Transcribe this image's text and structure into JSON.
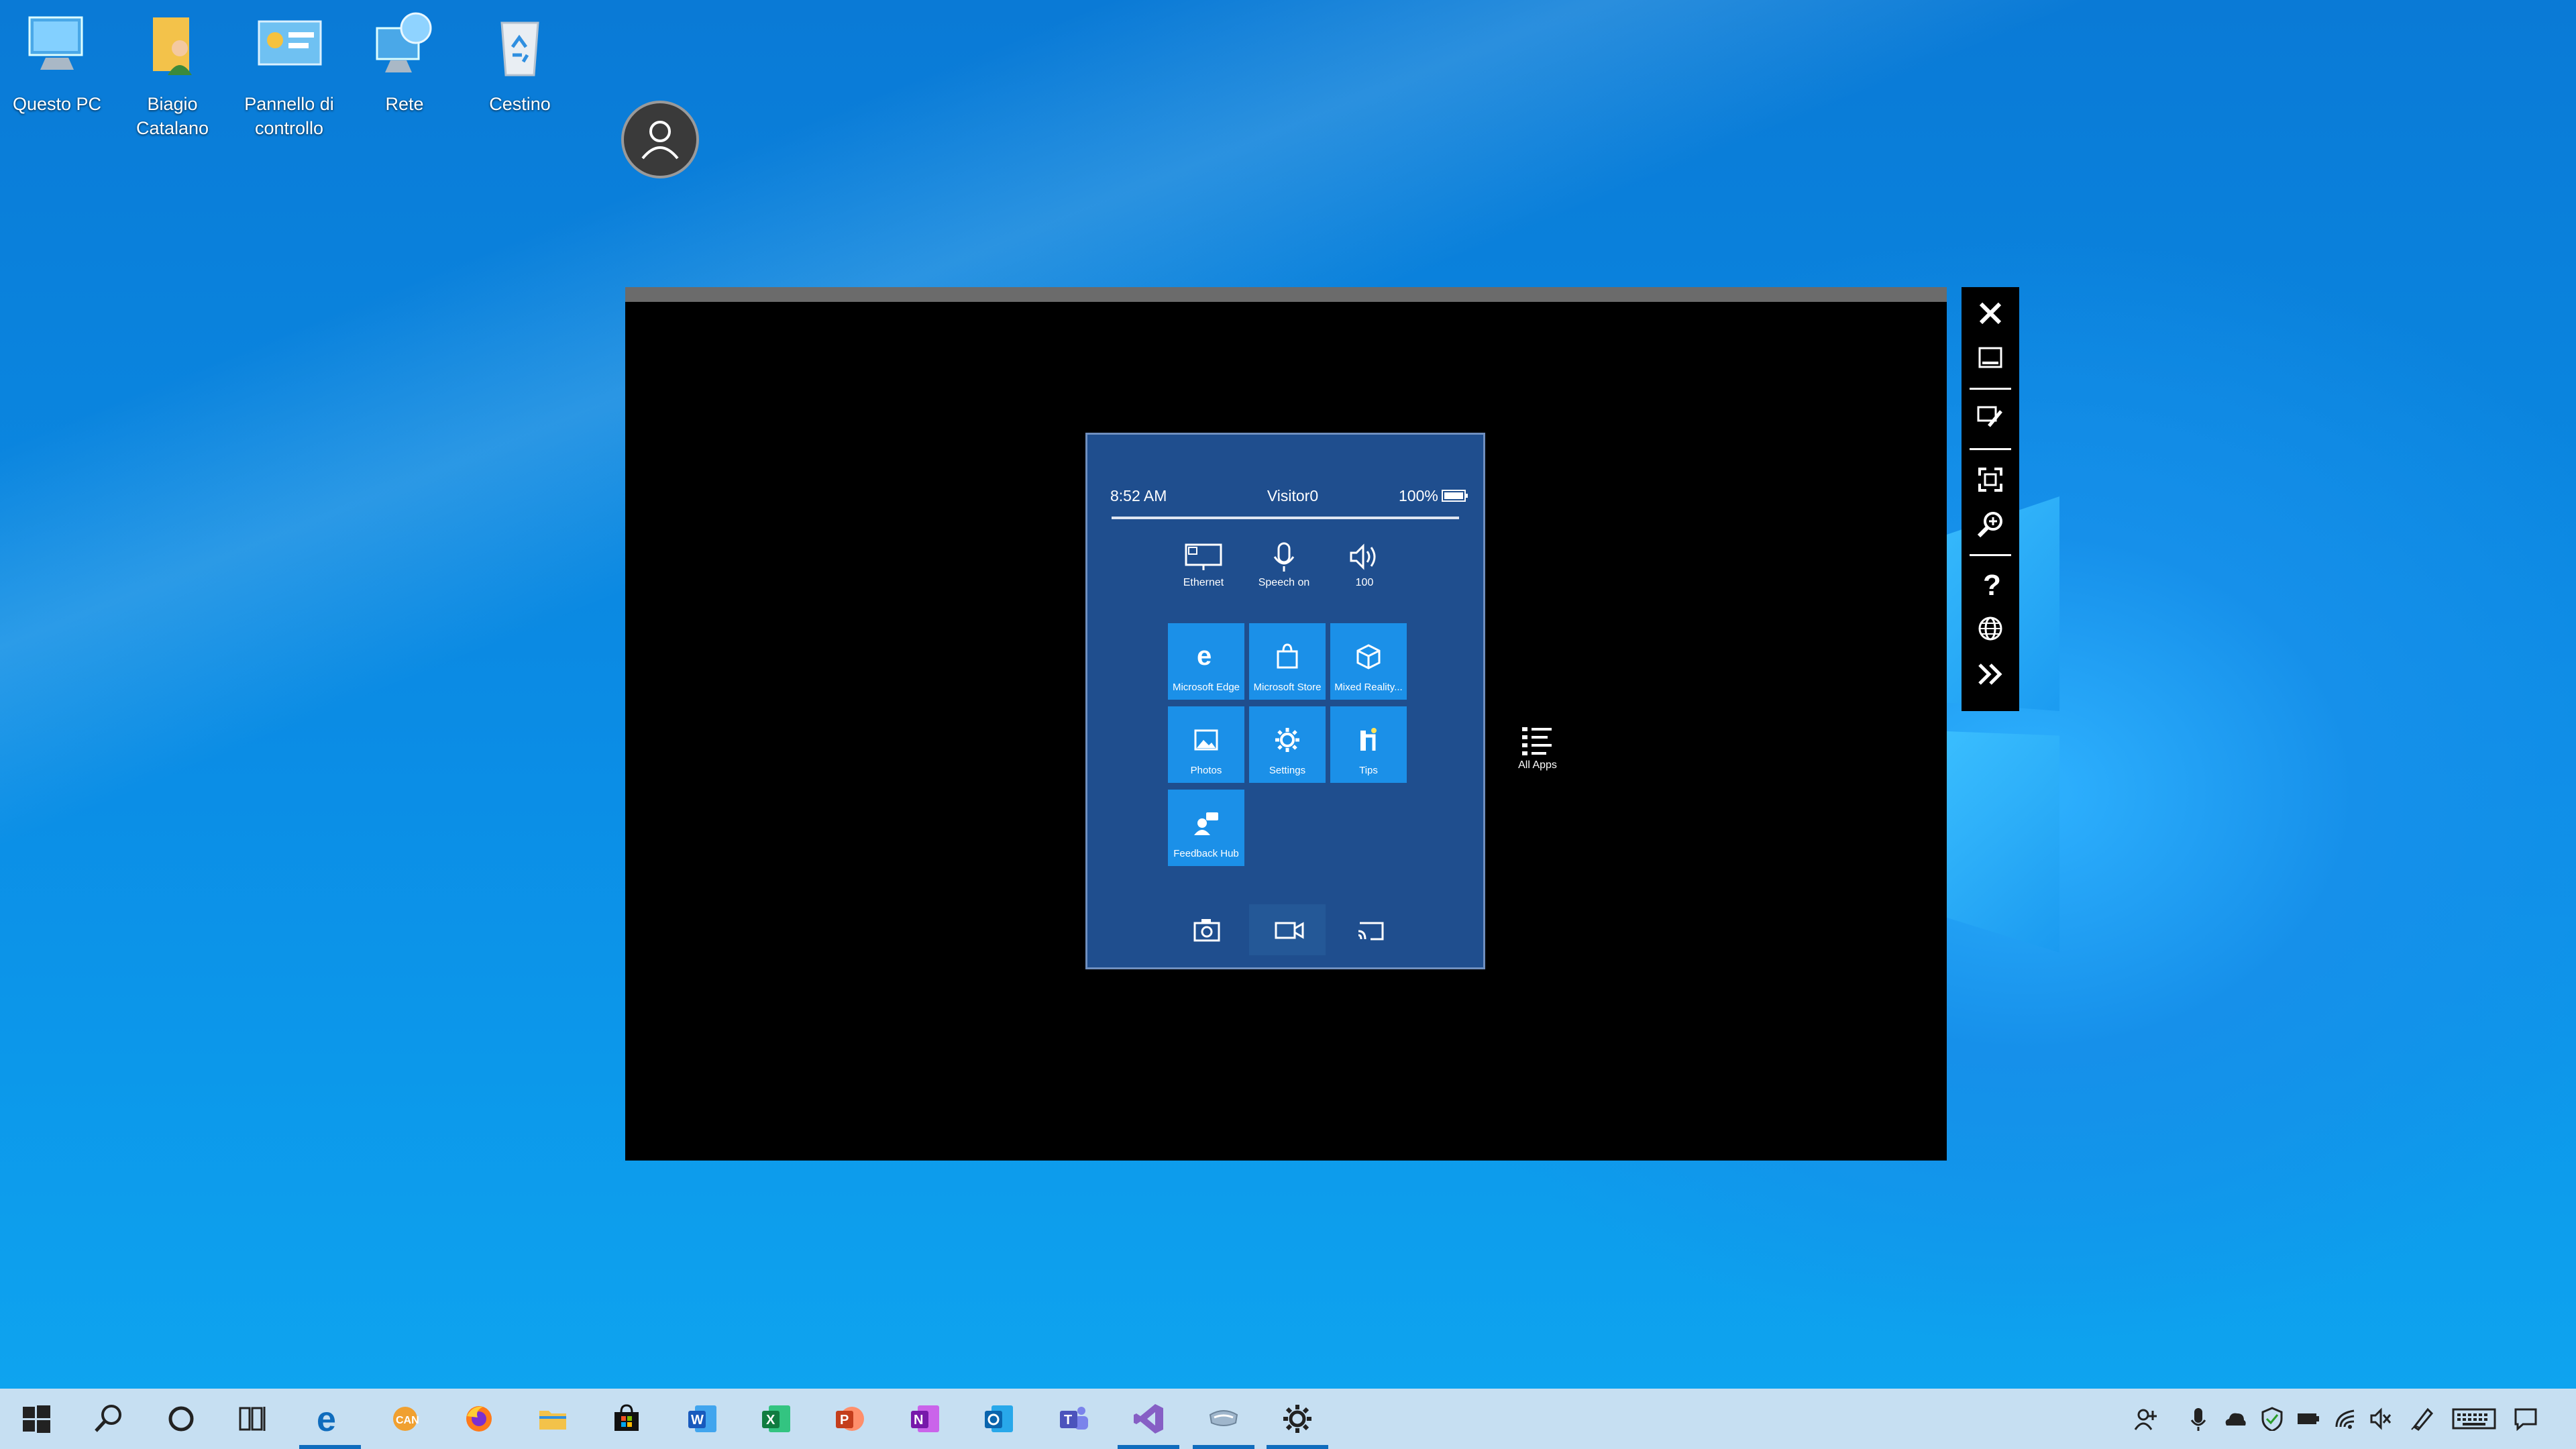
{
  "desktop": {
    "icons": [
      {
        "label": "Questo PC"
      },
      {
        "label": "Biagio Catalano"
      },
      {
        "label": "Pannello di controllo"
      },
      {
        "label": "Rete"
      },
      {
        "label": "Cestino"
      }
    ]
  },
  "emulator": {
    "status": {
      "time": "8:52 AM",
      "user": "Visitor0",
      "battery": "100%"
    },
    "quick_actions": [
      {
        "label": "Ethernet",
        "icon": "monitor-network-icon"
      },
      {
        "label": "Speech on",
        "icon": "microphone-icon"
      },
      {
        "label": "100",
        "icon": "volume-icon"
      }
    ],
    "tiles": [
      {
        "label": "Microsoft Edge",
        "icon": "edge-icon"
      },
      {
        "label": "Microsoft Store",
        "icon": "store-icon"
      },
      {
        "label": "Mixed Reality...",
        "icon": "cube-icon"
      },
      {
        "label": "Photos",
        "icon": "photos-icon"
      },
      {
        "label": "Settings",
        "icon": "gear-icon"
      },
      {
        "label": "Tips",
        "icon": "tips-icon"
      },
      {
        "label": "Feedback Hub",
        "icon": "feedback-icon"
      }
    ],
    "all_apps": "All Apps",
    "bottom_actions": [
      "camera-icon",
      "video-icon",
      "cast-icon"
    ]
  },
  "toolbar": {
    "tools": [
      "close-icon",
      "minimize-icon",
      "tools-icon",
      "fit-screen-icon",
      "zoom-icon",
      "help-icon",
      "globe-icon",
      "expand-icon"
    ]
  },
  "taskbar": {
    "apps": [
      "start-icon",
      "search-icon",
      "cortana-icon",
      "task-view-icon",
      "edge-icon",
      "canary-icon",
      "firefox-icon",
      "file-explorer-icon",
      "store-icon",
      "word-icon",
      "excel-icon",
      "powerpoint-icon",
      "onenote-icon",
      "outlook-icon",
      "teams-icon",
      "visual-studio-icon",
      "hololens-emulator-icon",
      "settings-icon"
    ],
    "tray": [
      "people-icon",
      "microphone-icon",
      "onedrive-icon",
      "defender-icon",
      "battery-icon",
      "wifi-icon",
      "volume-muted-icon",
      "pen-icon",
      "keyboard-icon",
      "notifications-icon"
    ]
  },
  "colors": {
    "start_bg": "#1f4e8e",
    "tile": "#1b90e8",
    "taskbar": "#c6dff2",
    "accent": "#0f6cbd"
  }
}
